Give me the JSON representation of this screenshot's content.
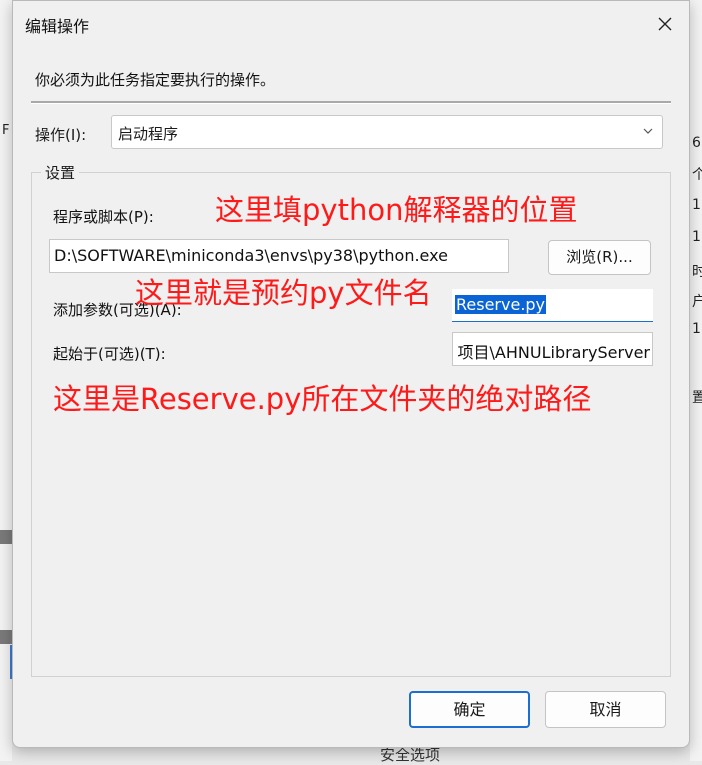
{
  "background": {
    "left_fragments": [
      "F"
    ],
    "right_fragments": [
      "6",
      "个",
      "1",
      "1",
      "时",
      "户",
      "1",
      "置"
    ],
    "bottom_text": "安全选项"
  },
  "dialog": {
    "title": "编辑操作",
    "close_icon": "close-icon",
    "instruction": "你必须为此任务指定要执行的操作。",
    "action_label": "操作(I):",
    "action_value": "启动程序",
    "settings_group_title": "设置",
    "program_label": "程序或脚本(P):",
    "program_value": "D:\\SOFTWARE\\miniconda3\\envs\\py38\\python.exe",
    "browse_button": "浏览(R)...",
    "args_label": "添加参数(可选)(A):",
    "args_value": "Reserve.py",
    "startin_label": "起始于(可选)(T):",
    "startin_value": "项目\\AHNULibraryServer",
    "ok_button": "确定",
    "cancel_button": "取消"
  },
  "annotations": {
    "program_note": "这里填python解释器的位置",
    "args_note": "这里就是预约py文件名",
    "startin_note": "这里是Reserve.py所在文件夹的绝对路径"
  },
  "colors": {
    "annotation": "#ff1a1a",
    "selection": "#0a64d6",
    "focus_border": "#1a6fd0"
  }
}
